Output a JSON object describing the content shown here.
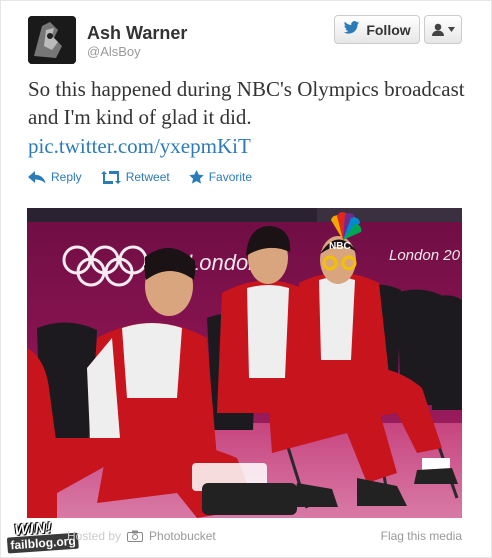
{
  "tweet": {
    "author_name": "Ash Warner",
    "author_handle": "@AlsBoy",
    "text": "So this happened during NBC's Olympics broadcast and I'm kind of glad it did.",
    "link": "pic.twitter.com/yxepmKiT",
    "avatar_icon": "avatar-image"
  },
  "header": {
    "follow_label": "Follow",
    "follow_icon": "twitter-bird-icon",
    "user_menu_icon": "user-icon"
  },
  "actions": [
    {
      "label": "Reply",
      "icon": "reply-icon"
    },
    {
      "label": "Retweet",
      "icon": "retweet-icon"
    },
    {
      "label": "Favorite",
      "icon": "star-icon"
    }
  ],
  "media": {
    "banner_text_1": "London",
    "banner_text_2": "London 20",
    "network_logo": "NBC"
  },
  "footer": {
    "hosted_by": "Hosted by",
    "hosted_service": "Photobucket",
    "flag_label": "Flag this media"
  },
  "watermark": {
    "line1": "WIN!",
    "line2": "failblog.org"
  },
  "colors": {
    "link": "#2b7bb9",
    "photo_wall": "#86104f",
    "jacket_red": "#c8141c"
  }
}
